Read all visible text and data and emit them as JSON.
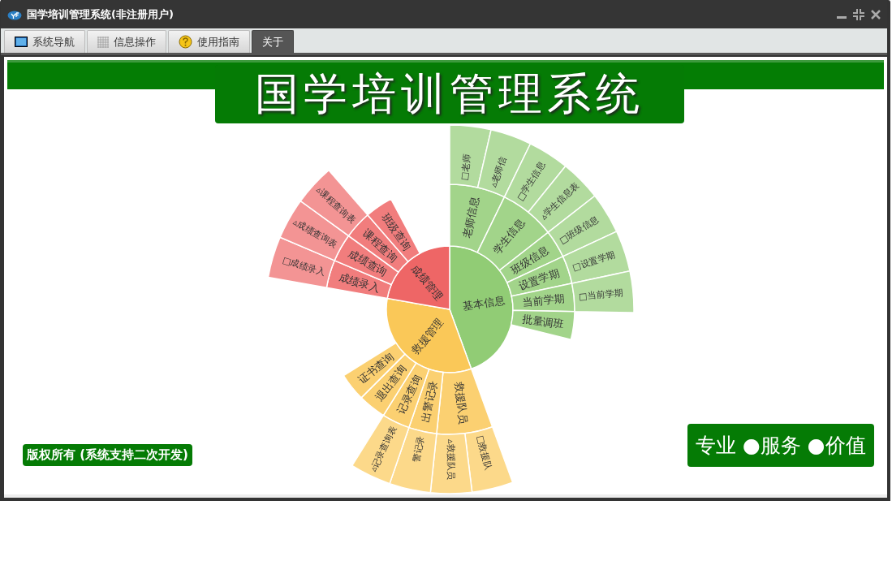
{
  "window": {
    "title": "国学培训管理系统(非注册用户)"
  },
  "tabs": [
    {
      "label": "系统导航",
      "kind": "monitor",
      "selected": false
    },
    {
      "label": "信息操作",
      "kind": "grid",
      "selected": false
    },
    {
      "label": "使用指南",
      "kind": "help",
      "selected": false
    },
    {
      "label": "关于",
      "kind": "none",
      "selected": true
    }
  ],
  "banner": {
    "title": "国学培训管理系统"
  },
  "sunburst": {
    "nodes": [
      {
        "label": "基本信息",
        "color": "#91cc75",
        "children": [
          {
            "label": "老师信息",
            "children": [
              {
                "label": "□老师"
              },
              {
                "label": "▵老师信"
              }
            ]
          },
          {
            "label": "学生信息",
            "children": [
              {
                "label": "□学生信息"
              },
              {
                "label": "▵学生信息表"
              }
            ]
          },
          {
            "label": "班级信息",
            "children": [
              {
                "label": "□班级信息"
              }
            ]
          },
          {
            "label": "设置学期",
            "children": [
              {
                "label": "□设置学期"
              }
            ]
          },
          {
            "label": "当前学期",
            "children": [
              {
                "label": "□当前学期"
              }
            ]
          },
          {
            "label": "批量调班"
          }
        ]
      },
      {
        "label": "救援管理",
        "color": "#fac858",
        "children": [
          {
            "label": "救援队员",
            "children": [
              {
                "label": "□救援队"
              },
              {
                "label": "▵救援队员"
              }
            ]
          },
          {
            "label": "出警记录",
            "children": [
              {
                "label": "警记录"
              }
            ]
          },
          {
            "label": "记录查询",
            "children": [
              {
                "label": "▵记录查询表"
              }
            ]
          },
          {
            "label": "退出查询"
          },
          {
            "label": "证书查询"
          }
        ]
      },
      {
        "label": "成绩管理",
        "color": "#ee6666",
        "children": [
          {
            "label": "成绩录入",
            "children": [
              {
                "label": "□成绩录入"
              }
            ]
          },
          {
            "label": "成绩查询",
            "children": [
              {
                "label": "▵成绩查询表"
              }
            ]
          },
          {
            "label": "课程查询",
            "children": [
              {
                "label": "▵课程查询表"
              }
            ]
          },
          {
            "label": "班级查询"
          }
        ]
      }
    ]
  },
  "footer_left": "版权所有 (系统支持二次开发)",
  "footer_right": "专业 ●服务 ●价值"
}
